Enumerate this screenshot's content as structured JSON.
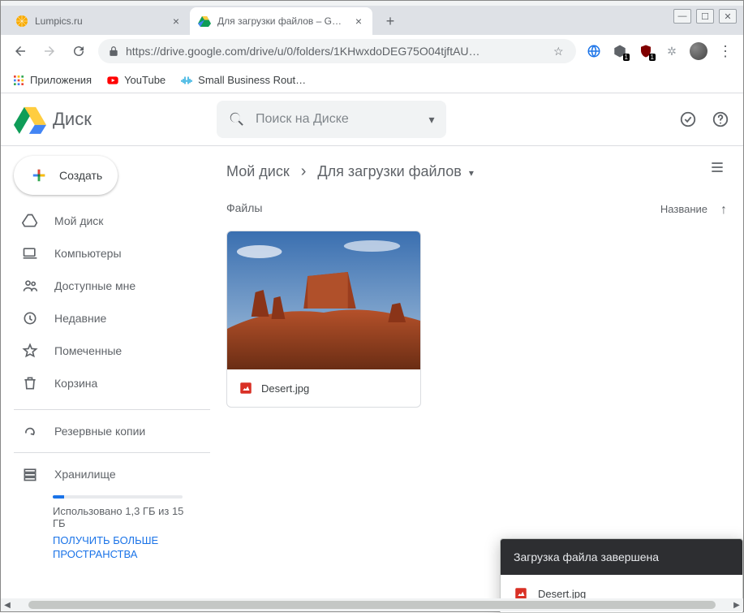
{
  "window": {
    "controls": {
      "minimize": "—",
      "maximize": "☐",
      "close": "✕"
    }
  },
  "tabs": [
    {
      "title": "Lumpics.ru",
      "active": false,
      "favicon": "orange"
    },
    {
      "title": "Для загрузки файлов – Google Д",
      "active": true,
      "favicon": "drive"
    }
  ],
  "browser": {
    "url": "https://drive.google.com/drive/u/0/folders/1KHwxdoDEG75O04tjftAU…",
    "bookmarks": [
      {
        "label": "Приложения",
        "icon": "apps"
      },
      {
        "label": "YouTube",
        "icon": "youtube"
      },
      {
        "label": "Small Business Rout…",
        "icon": "cisco"
      }
    ],
    "ext_badges": {
      "e1": "1",
      "e2": "1"
    }
  },
  "drive": {
    "logo_text": "Диск",
    "search_placeholder": "Поиск на Диске",
    "create_label": "Создать",
    "nav": [
      {
        "id": "mydrive",
        "label": "Мой диск"
      },
      {
        "id": "computers",
        "label": "Компьютеры"
      },
      {
        "id": "shared",
        "label": "Доступные мне"
      },
      {
        "id": "recent",
        "label": "Недавние"
      },
      {
        "id": "starred",
        "label": "Помеченные"
      },
      {
        "id": "trash",
        "label": "Корзина"
      },
      {
        "id": "backup",
        "label": "Резервные копии"
      },
      {
        "id": "storage",
        "label": "Хранилище"
      }
    ],
    "storage": {
      "text": "Использовано 1,3 ГБ из 15 ГБ",
      "link": "ПОЛУЧИТЬ БОЛЬШЕ ПРОСТРАНСТВА"
    },
    "breadcrumb": [
      {
        "label": "Мой диск"
      },
      {
        "label": "Для загрузки файлов"
      }
    ],
    "section_label": "Файлы",
    "sort_label": "Название",
    "files": [
      {
        "name": "Desert.jpg",
        "type": "image"
      }
    ],
    "upload_toast": {
      "header": "Загрузка файла завершена",
      "item": "Desert.jpg"
    }
  }
}
